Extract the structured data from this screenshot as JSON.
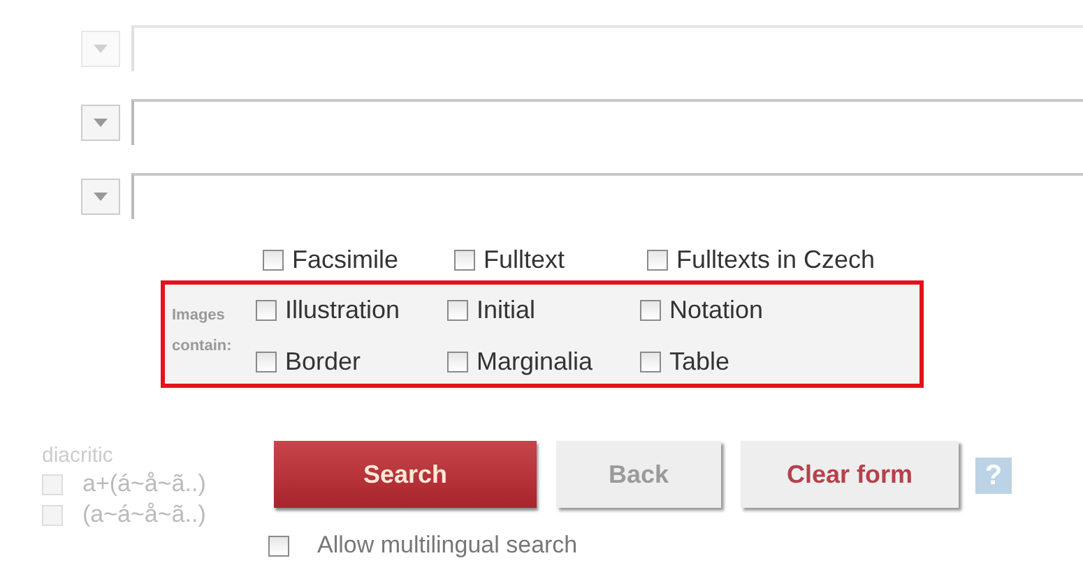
{
  "query_rows": [
    {
      "kind": "select-text",
      "faded": true
    },
    {
      "kind": "select-text",
      "faded": false
    },
    {
      "kind": "select-text",
      "faded": false
    }
  ],
  "document_types": [
    {
      "label": "Facsimile",
      "checked": false
    },
    {
      "label": "Fulltext",
      "checked": false
    },
    {
      "label": "Fulltexts in Czech",
      "checked": false
    }
  ],
  "images": {
    "label": "Images contain:",
    "options": [
      {
        "label": "Illustration",
        "checked": false
      },
      {
        "label": "Initial",
        "checked": false
      },
      {
        "label": "Notation",
        "checked": false
      },
      {
        "label": "Border",
        "checked": false
      },
      {
        "label": "Marginalia",
        "checked": false
      },
      {
        "label": "Table",
        "checked": false
      }
    ]
  },
  "diacritic": {
    "label": "diacritic",
    "options": [
      {
        "label": "a+(á~å~ã..)",
        "checked": false,
        "disabled": true
      },
      {
        "label": "(a~á~å~ã..)",
        "checked": false,
        "disabled": true
      }
    ]
  },
  "buttons": [
    {
      "label": "Search",
      "kind": "primary",
      "disabled": false
    },
    {
      "label": "Back",
      "kind": "secondary",
      "disabled": true
    },
    {
      "label": "Clear form",
      "kind": "secondary",
      "disabled": false
    }
  ],
  "help": {
    "label": "?"
  },
  "multilingual": {
    "label": "Allow multilingual search",
    "checked": false
  }
}
